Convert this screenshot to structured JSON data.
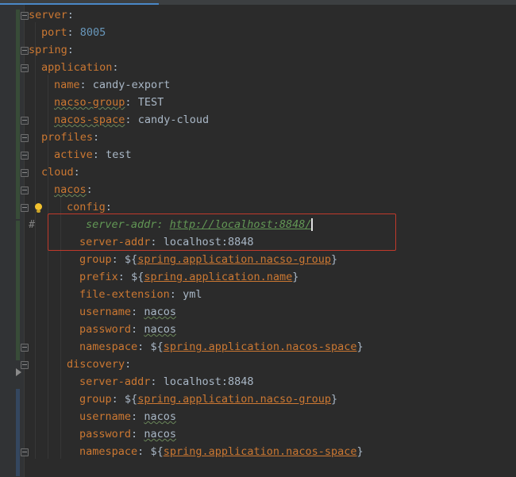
{
  "lines": {
    "l1": {
      "key": "server",
      "colon": ":"
    },
    "l2": {
      "key": "port",
      "colon": ":",
      "value": "8005"
    },
    "l3": {
      "key": "spring",
      "colon": ":"
    },
    "l4": {
      "key": "application",
      "colon": ":"
    },
    "l5": {
      "key": "name",
      "colon": ":",
      "value": "candy-export"
    },
    "l6": {
      "key": "nacso-group",
      "colon": ":",
      "value": "TEST"
    },
    "l7": {
      "key": "nacos-space",
      "colon": ":",
      "value": "candy-cloud"
    },
    "l8": {
      "key": "profiles",
      "colon": ":"
    },
    "l9": {
      "key": "active",
      "colon": ":",
      "value": "test"
    },
    "l10": {
      "key": "cloud",
      "colon": ":"
    },
    "l11": {
      "key": "nacos",
      "colon": ":"
    },
    "l12": {
      "key": "config",
      "colon": ":"
    },
    "l13": {
      "hash": "#",
      "comment": "server-addr: ",
      "url": "http://localhost:8848/"
    },
    "l14": {
      "key": "server-addr",
      "colon": ":",
      "value": "localhost:8848"
    },
    "l15": {
      "key": "group",
      "colon": ":",
      "pre": "${",
      "ref": "spring.application.nacso-group",
      "post": "}"
    },
    "l16": {
      "key": "prefix",
      "colon": ":",
      "pre": "${",
      "ref": "spring.application.name",
      "post": "}"
    },
    "l17": {
      "key": "file-extension",
      "colon": ":",
      "value": "yml"
    },
    "l18": {
      "key": "username",
      "colon": ":",
      "value": "nacos"
    },
    "l19": {
      "key": "password",
      "colon": ":",
      "value": "nacos"
    },
    "l20": {
      "key": "namespace",
      "colon": ":",
      "pre": "${",
      "ref": "spring.application.nacos-space",
      "post": "}"
    },
    "l21": {
      "key": "discovery",
      "colon": ":"
    },
    "l22": {
      "key": "server-addr",
      "colon": ":",
      "value": "localhost:8848"
    },
    "l23": {
      "key": "group",
      "colon": ":",
      "pre": "${",
      "ref": "spring.application.nacso-group",
      "post": "}"
    },
    "l24": {
      "key": "username",
      "colon": ":",
      "value": "nacos"
    },
    "l25": {
      "key": "password",
      "colon": ":",
      "value": "nacos"
    },
    "l26": {
      "key": "namespace",
      "colon": ":",
      "pre": "${",
      "ref": "spring.application.nacos-space",
      "post": "}"
    }
  },
  "colors": {
    "key": "#cc7832",
    "number": "#6897bb",
    "text": "#a9b7c6",
    "comment": "#629755",
    "highlight": "#c0392b",
    "background": "#2b2b2b"
  },
  "icons": [
    "intention-bulb-icon",
    "fold-marker-icon",
    "run-arrow-icon"
  ]
}
